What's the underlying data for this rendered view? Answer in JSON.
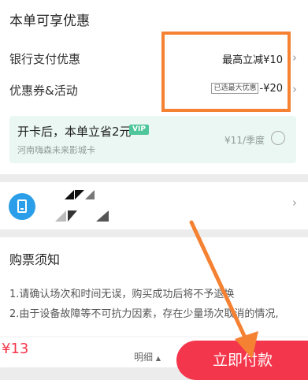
{
  "discounts": {
    "title": "本单可享优惠",
    "bank": {
      "label": "银行支付优惠",
      "value": "最高立减¥10"
    },
    "coupon": {
      "label": "优惠券&活动",
      "badge": "已选最大优惠",
      "value": "-¥20"
    }
  },
  "vip_card": {
    "title": "开卡后，本单立省2元",
    "tag": "VIP",
    "subtitle": "河南嗨森未来影城卡",
    "price": "¥11/季度"
  },
  "notice": {
    "title": "购票须知",
    "lines": [
      "1.请确认场次和时间无误，购买成功后将不予退换",
      "2.由于设备故障等不可抗力因素，存在少量场次取消的情况,"
    ]
  },
  "bottom_bar": {
    "price": "¥13",
    "detail": "明细",
    "pay_button": "立即付款"
  },
  "colors": {
    "accent": "#f4364c",
    "highlight": "#f58233",
    "vip": "#4ec59a",
    "phone": "#2a9ee8"
  },
  "icons": [
    "chevron-right-icon",
    "phone-icon",
    "radio-unchecked-icon",
    "caret-up-icon"
  ]
}
